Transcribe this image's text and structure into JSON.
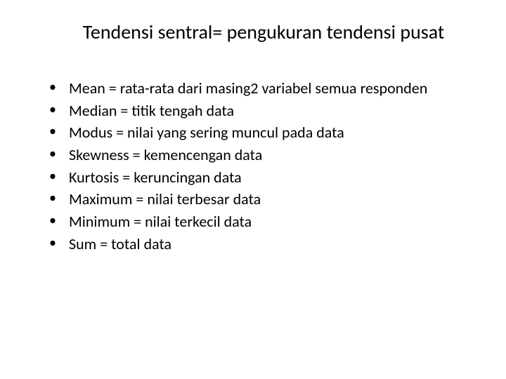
{
  "slide": {
    "title": "Tendensi sentral= pengukuran tendensi pusat",
    "bullets": [
      "Mean = rata-rata dari masing2 variabel semua responden",
      "Median = titik tengah data",
      "Modus = nilai yang sering muncul pada data",
      "Skewness = kemencengan data",
      "Kurtosis = keruncingan data",
      "Maximum = nilai terbesar data",
      "Minimum = nilai terkecil data",
      "Sum = total data"
    ]
  }
}
